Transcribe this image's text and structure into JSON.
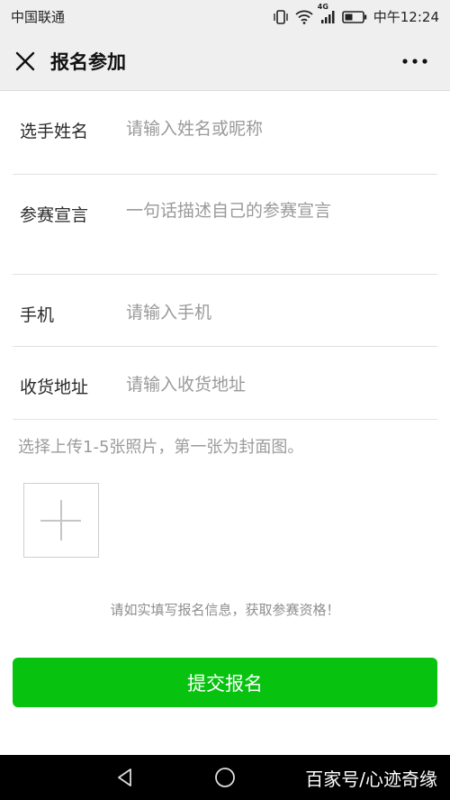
{
  "status_bar": {
    "carrier": "中国联通",
    "network": "4G",
    "time": "中午12:24"
  },
  "header": {
    "title": "报名参加",
    "close_icon": "close-icon",
    "more_icon": "more-dots-icon"
  },
  "form": {
    "fields": [
      {
        "label": "选手姓名",
        "placeholder": "请输入姓名或昵称",
        "value": ""
      },
      {
        "label": "参赛宣言",
        "placeholder": "一句话描述自己的参赛宣言",
        "value": ""
      },
      {
        "label": "手机",
        "placeholder": "请输入手机",
        "value": ""
      },
      {
        "label": "收货地址",
        "placeholder": "请输入收货地址",
        "value": ""
      }
    ],
    "upload_hint": "选择上传1-5张照片，第一张为封面图。",
    "upload_icon": "plus-icon",
    "notice": "请如实填写报名信息，获取参赛资格！",
    "submit_label": "提交报名"
  },
  "system_nav": {
    "back_icon": "back-triangle-icon",
    "home_icon": "home-circle-icon",
    "watermark": "百家号/心迹奇缘"
  },
  "colors": {
    "accent": "#07c30f",
    "header_bg": "#efefef",
    "placeholder": "#9a9a9a"
  }
}
